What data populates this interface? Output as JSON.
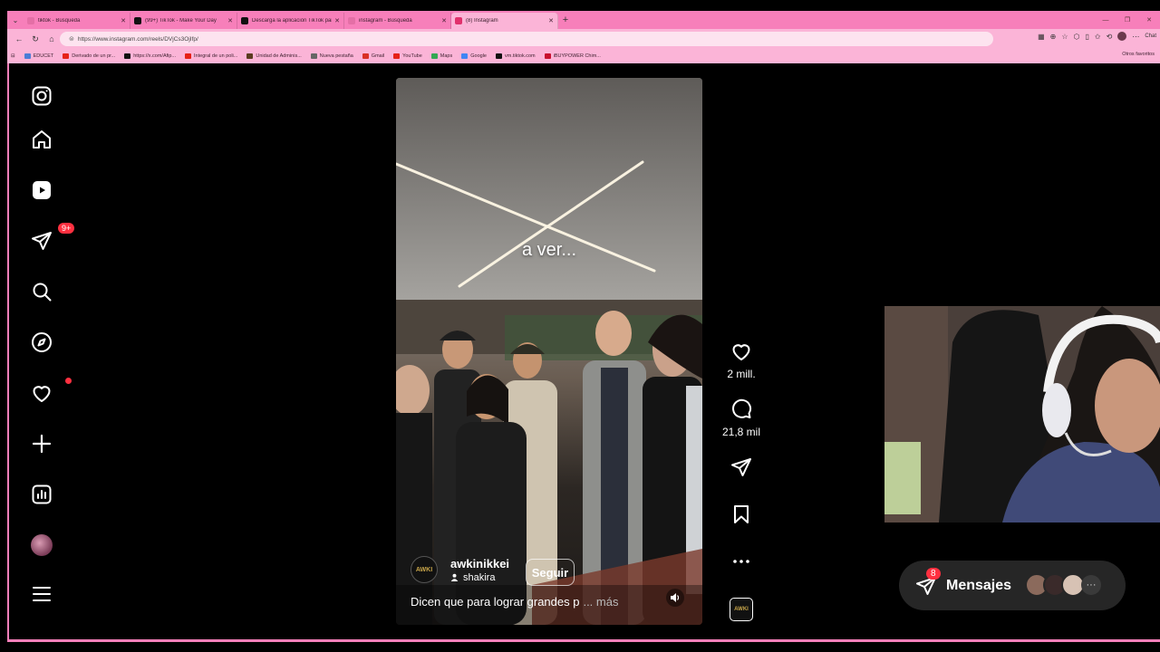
{
  "browser": {
    "tabs": [
      {
        "label": "tiktok - Búsqueda",
        "color": "#e46fa6",
        "active": false
      },
      {
        "label": "(99+) TikTok - Make Your Day",
        "color": "#111111",
        "active": false
      },
      {
        "label": "Descarga la aplicación TikTok para",
        "color": "#111111",
        "active": false
      },
      {
        "label": "instagram - Búsqueda",
        "color": "#e46fa6",
        "active": false
      },
      {
        "label": "(8) Instagram",
        "color": "#e1306c",
        "active": true
      }
    ],
    "new_tab": "+",
    "url": "https://www.instagram.com/reels/DVjCs3OjIfp/",
    "chat_label": "Chat",
    "bookmarks": [
      {
        "label": "EDUCET",
        "color": "#4a7dd6"
      },
      {
        "label": "Derivado de un pr...",
        "color": "#e62117"
      },
      {
        "label": "https://x.com/Afip...",
        "color": "#111111"
      },
      {
        "label": "Integral de un poli...",
        "color": "#e62117"
      },
      {
        "label": "Unidad de Adminis...",
        "color": "#5a3b1f"
      },
      {
        "label": "Nueva pestaña",
        "color": "#666666"
      },
      {
        "label": "Gmail",
        "color": "#d93025"
      },
      {
        "label": "YouTube",
        "color": "#e62117"
      },
      {
        "label": "Maps",
        "color": "#34a853"
      },
      {
        "label": "Google",
        "color": "#4285f4"
      },
      {
        "label": "vm.tiktok.com",
        "color": "#111111"
      },
      {
        "label": "iBUYPOWER Chim...",
        "color": "#c8102e"
      }
    ],
    "other_bookmarks": "Otros favoritos"
  },
  "sidebar": {
    "notifications_badge": "9+",
    "items": [
      "instagram-logo",
      "home",
      "reels",
      "direct",
      "search",
      "explore",
      "notifications",
      "create",
      "insights",
      "profile",
      "more"
    ]
  },
  "reel": {
    "caption_overlay": "a ver...",
    "username": "awkinikkei",
    "audio": "shakira",
    "follow_label": "Seguir",
    "description": "Dicen que para lograr grandes p",
    "more_label": "... más",
    "avatar_text": "AWKI"
  },
  "actions": {
    "likes": "2 mill.",
    "comments": "21,8 mil",
    "audio_thumb_text": "AWKI"
  },
  "messages": {
    "label": "Mensajes",
    "badge": "8",
    "more": "···"
  }
}
